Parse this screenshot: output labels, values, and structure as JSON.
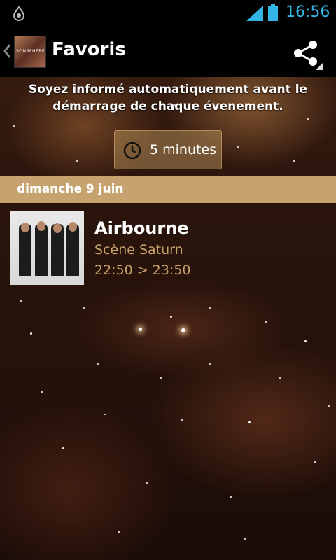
{
  "status_bar": {
    "time": "16:56",
    "accent_color": "#33b5e5"
  },
  "action_bar": {
    "title": "Favoris",
    "app_logo_text": "SONSPHERE",
    "share_icon": "share-icon",
    "up_icon": "chevron-left-icon"
  },
  "notification": {
    "info": "Soyez informé automatiquement avant le démarrage de chaque évenement.",
    "reminder_label": "5 minutes",
    "reminder_icon": "clock-icon"
  },
  "schedule": {
    "date_header": "dimanche 9 juin",
    "header_color": "#c6a36e",
    "events": [
      {
        "name": "Airbourne",
        "stage": "Scène Saturn",
        "time": "22:50 > 23:50"
      }
    ]
  }
}
